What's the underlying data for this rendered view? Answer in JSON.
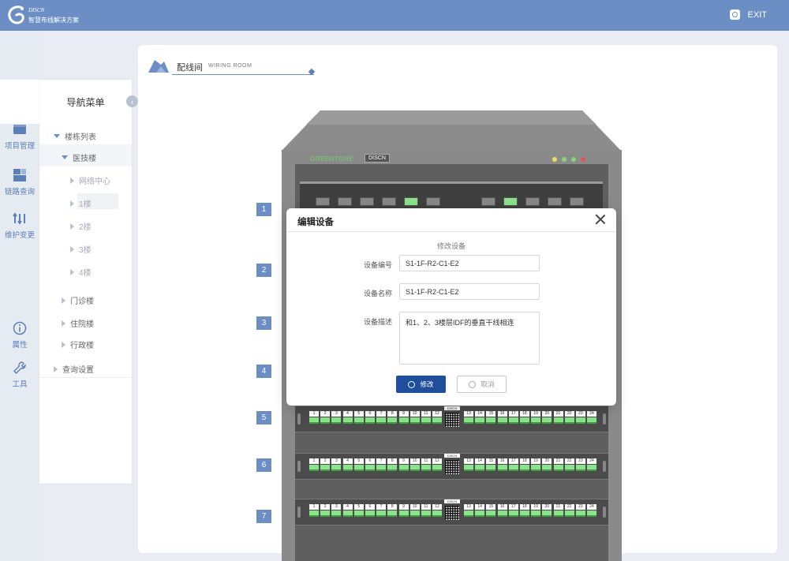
{
  "header": {
    "brand_en": "DISCN",
    "brand_zh": "智慧布线解决方案",
    "exit_label": "EXIT"
  },
  "rail": {
    "items": [
      {
        "label": "项目管理",
        "icon": "folder-icon"
      },
      {
        "label": "链路查询",
        "icon": "grid-icon"
      },
      {
        "label": "维护变更",
        "icon": "sort-arrows-icon"
      },
      {
        "label": "属性",
        "icon": "info-icon"
      },
      {
        "label": "工具",
        "icon": "wrench-icon"
      }
    ]
  },
  "nav": {
    "title": "导航菜单",
    "items": [
      {
        "label": "楼栋列表"
      },
      {
        "label": "医技楼"
      },
      {
        "label": "网络中心"
      },
      {
        "label": "1楼"
      },
      {
        "label": "2楼"
      },
      {
        "label": "3楼"
      },
      {
        "label": "4楼"
      },
      {
        "label": "门诊楼"
      },
      {
        "label": "住院楼"
      },
      {
        "label": "行政楼"
      },
      {
        "label": "查询设置"
      }
    ]
  },
  "room": {
    "title_zh": "配线间",
    "title_en": "WIRING  ROOM"
  },
  "cabinet": {
    "logo": "GREENTONE",
    "brand": "DISCN",
    "led_colors": [
      "#e6e35a",
      "#7ed67e",
      "#7ed67e",
      "#e0555b"
    ],
    "units": [
      "1",
      "2",
      "3",
      "4",
      "5",
      "6",
      "7"
    ],
    "panel_label": "DISCN",
    "ports_left": [
      "1",
      "2",
      "3",
      "4",
      "5",
      "6",
      "7",
      "8",
      "9",
      "10",
      "11",
      "12"
    ],
    "ports_right": [
      "13",
      "14",
      "15",
      "16",
      "17",
      "18",
      "19",
      "20",
      "21",
      "22",
      "23",
      "24"
    ]
  },
  "dialog": {
    "title": "编辑设备",
    "subtitle": "修改设备",
    "fields": {
      "code_label": "设备编号",
      "code_value": "S1-1F-R2-C1-E2",
      "name_label": "设备名称",
      "name_value": "S1-1F-R2-C1-E2",
      "desc_label": "设备描述",
      "desc_value": "和1、2、3楼层IDF的垂直干线相连"
    },
    "ok_label": "修改",
    "cancel_label": "取消"
  }
}
